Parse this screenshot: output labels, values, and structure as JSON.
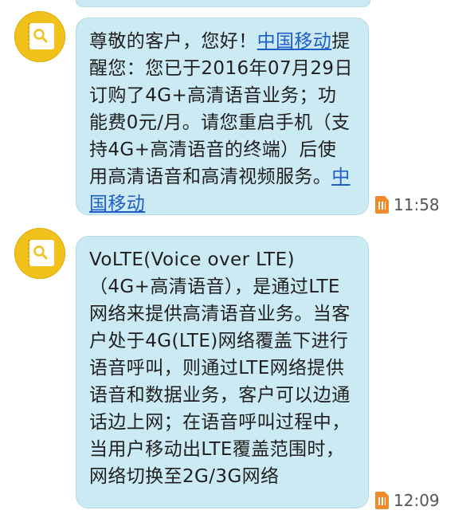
{
  "messages": [
    {
      "lead": "尊敬的客户，您好！",
      "link1": "中国移动",
      "body": "提醒您：您已于2016年07月29日订购了4G+高清语音业务；功能费0元/月。请您重启手机（支持4G+高清语音的终端）后使用高清语音和高清视频服务。",
      "link2": "中国移动",
      "time": "11:58"
    },
    {
      "body": "VoLTE(Voice over LTE)（4G+高清语音），是通过LTE网络来提供高清语音业务。当客户处于4G(LTE)网络覆盖下进行语音呼叫，则通过LTE网络提供语音和数据业务，客户可以边通话边上网；在语音呼叫过程中，当用户移动出LTE覆盖范围时，网络切换至2G/3G网络",
      "time": "12:09"
    }
  ],
  "icons": {
    "avatar": "notebook-search-icon",
    "sim": "sim-card-icon"
  }
}
